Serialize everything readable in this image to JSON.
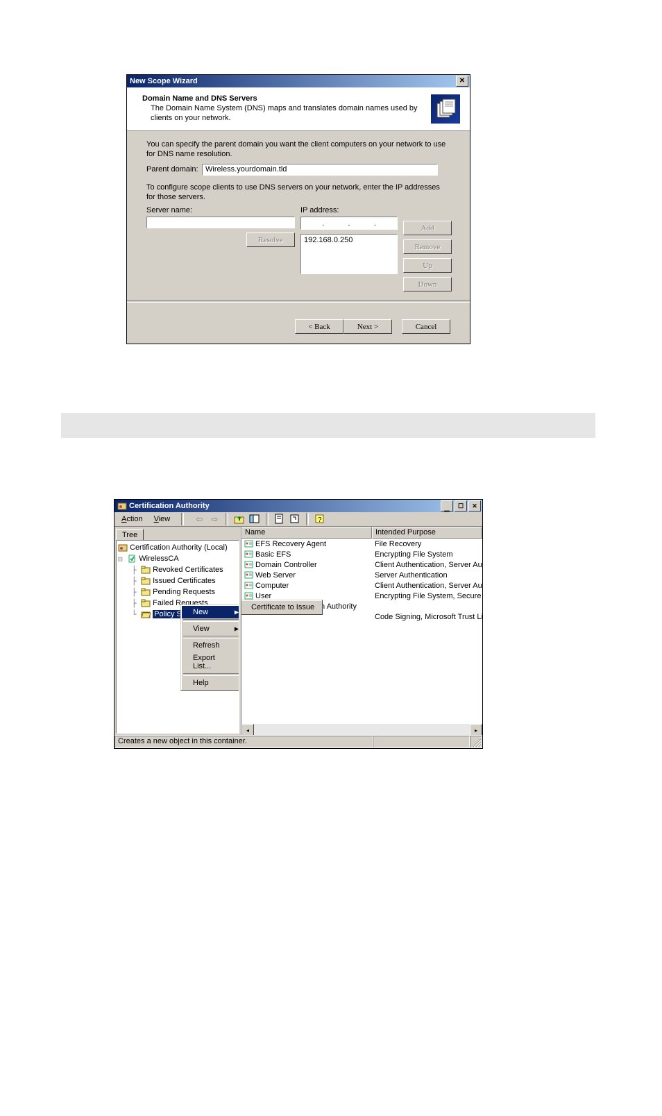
{
  "wizard": {
    "title": "New Scope Wizard",
    "header_title": "Domain Name and DNS Servers",
    "header_desc": "The Domain Name System (DNS) maps and translates domain names used by clients on your network.",
    "body_text1": "You can specify the parent domain you want the client computers on your network to use for DNS name resolution.",
    "parent_domain_label": "Parent domain:",
    "parent_domain_value": "Wireless.yourdomain.tld",
    "body_text2": "To configure scope clients to use DNS servers on your network, enter the IP addresses for those servers.",
    "server_name_label": "Server name:",
    "server_name_value": "",
    "ip_address_label": "IP address:",
    "ip_value_parts": [
      "",
      "",
      "",
      ""
    ],
    "ip_list_item": "192.168.0.250",
    "buttons": {
      "resolve": "Resolve",
      "add": "Add",
      "remove": "Remove",
      "up": "Up",
      "down": "Down",
      "back": "< Back",
      "next": "Next >",
      "cancel": "Cancel"
    }
  },
  "mmc": {
    "title": "Certification Authority",
    "menu": {
      "action": "Action",
      "view": "View"
    },
    "tree_tab": "Tree",
    "tree": {
      "root": "Certification Authority (Local)",
      "ca": "WirelessCA",
      "nodes": [
        "Revoked Certificates",
        "Issued Certificates",
        "Pending Requests",
        "Failed Requests",
        "Policy Settings"
      ]
    },
    "list_headers": {
      "name": "Name",
      "purpose": "Intended Purpose"
    },
    "list_rows": [
      {
        "name": "EFS Recovery Agent",
        "purpose": "File Recovery"
      },
      {
        "name": "Basic EFS",
        "purpose": "Encrypting File System"
      },
      {
        "name": "Domain Controller",
        "purpose": "Client Authentication, Server Authentic"
      },
      {
        "name": "Web Server",
        "purpose": "Server Authentication"
      },
      {
        "name": "Computer",
        "purpose": "Client Authentication, Server Authentic"
      },
      {
        "name": "User",
        "purpose": "Encrypting File System, Secure Email, C"
      },
      {
        "name": "",
        "purpose": ""
      },
      {
        "name": "",
        "purpose": "Code Signing, Microsoft Trust List Signi"
      }
    ],
    "list_tail_fragment": "n Authority",
    "context_menu": {
      "new": "New",
      "view": "View",
      "refresh": "Refresh",
      "export": "Export List...",
      "help": "Help"
    },
    "submenu": {
      "cert_to_issue": "Certificate to Issue"
    },
    "status": "Creates a new object in this container."
  }
}
